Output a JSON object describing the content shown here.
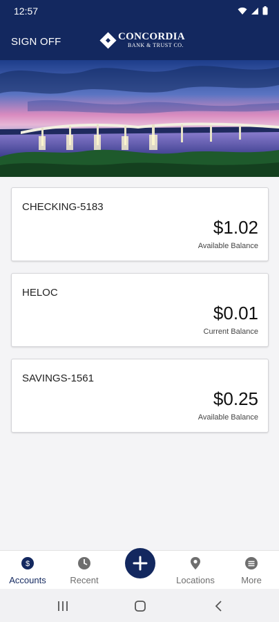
{
  "status_bar": {
    "time": "12:57"
  },
  "header": {
    "signoff_label": "SIGN OFF",
    "logo_name": "CONCORDIA",
    "logo_sub": "BANK & TRUST CO.",
    "brand_color": "#13285f"
  },
  "accounts": [
    {
      "name": "CHECKING-5183",
      "amount": "$1.02",
      "balance_label": "Available Balance"
    },
    {
      "name": "HELOC",
      "amount": "$0.01",
      "balance_label": "Current Balance"
    },
    {
      "name": "SAVINGS-1561",
      "amount": "$0.25",
      "balance_label": "Available Balance"
    }
  ],
  "bottom_nav": {
    "items": [
      {
        "label": "Accounts",
        "icon": "dollar-circle-icon",
        "active": true
      },
      {
        "label": "Recent",
        "icon": "clock-icon",
        "active": false
      },
      {
        "label": "",
        "icon": "plus-icon",
        "active": false
      },
      {
        "label": "Locations",
        "icon": "map-pin-icon",
        "active": false
      },
      {
        "label": "More",
        "icon": "more-icon",
        "active": false
      }
    ]
  },
  "system_nav": {
    "buttons": [
      "recents-icon",
      "home-icon",
      "back-icon"
    ]
  }
}
